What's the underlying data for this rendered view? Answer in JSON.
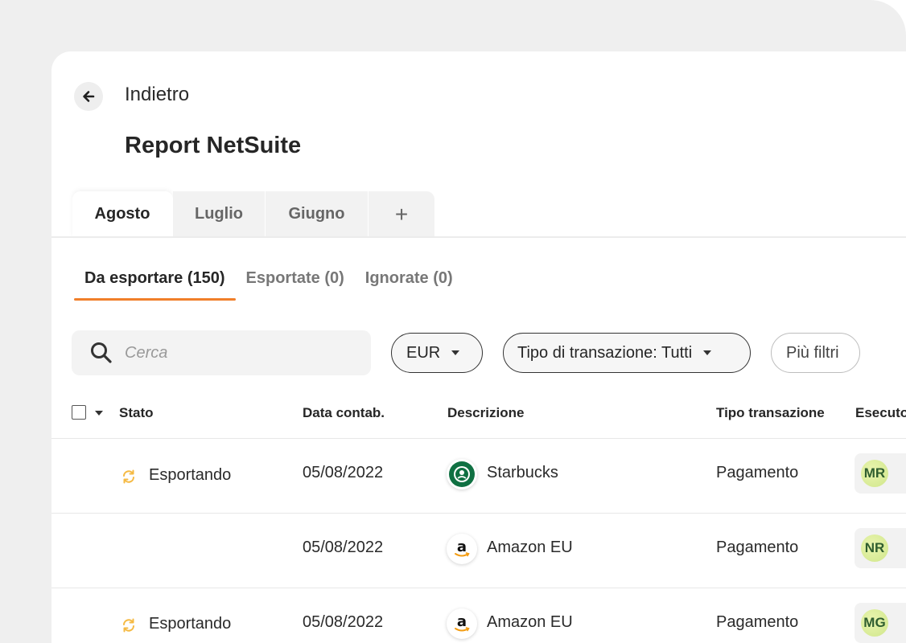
{
  "header": {
    "back_label": "Indietro",
    "title": "Report NetSuite"
  },
  "month_tabs": [
    {
      "label": "Agosto",
      "active": true
    },
    {
      "label": "Luglio",
      "active": false
    },
    {
      "label": "Giugno",
      "active": false
    },
    {
      "label": "+",
      "active": false
    }
  ],
  "status_tabs": [
    {
      "label": "Da esportare (150)",
      "active": true
    },
    {
      "label": "Esportate (0)",
      "active": false
    },
    {
      "label": "Ignorate (0)",
      "active": false
    }
  ],
  "search": {
    "placeholder": "Cerca",
    "value": ""
  },
  "filters": {
    "currency": "EUR",
    "transaction_type": "Tipo di transazione: Tutti",
    "more": "Più filtri"
  },
  "table": {
    "columns": [
      "Stato",
      "Data contab.",
      "Descrizione",
      "Tipo transazione",
      "Esecutore"
    ],
    "rows": [
      {
        "status": "Esportando",
        "date": "05/08/2022",
        "merchant": "Starbucks",
        "merchant_icon": "starbucks-logo",
        "type": "Pagamento",
        "initials": "MR"
      },
      {
        "status": "",
        "date": "05/08/2022",
        "merchant": "Amazon  EU",
        "merchant_icon": "amazon-logo",
        "type": "Pagamento",
        "initials": "NR"
      },
      {
        "status": "Esportando",
        "date": "05/08/2022",
        "merchant": "Amazon  EU",
        "merchant_icon": "amazon-logo",
        "type": "Pagamento",
        "initials": "MG"
      }
    ]
  },
  "colors": {
    "accent": "#f07f2a",
    "sync_icon": "#f5b942",
    "avatar_fill": "#d8ec9a",
    "background": "#efefef"
  }
}
